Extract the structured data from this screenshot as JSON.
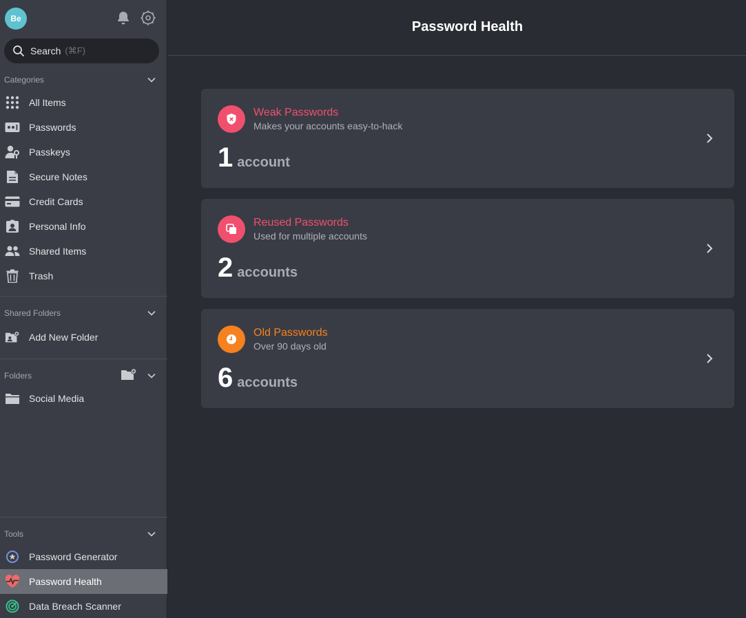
{
  "user": {
    "avatar_initials": "Be",
    "avatar_color": "#5fc2cf"
  },
  "search": {
    "label": "Search",
    "shortcut": "(⌘F)"
  },
  "categories": {
    "title": "Categories",
    "items": [
      {
        "label": "All Items",
        "icon": "grid-icon"
      },
      {
        "label": "Passwords",
        "icon": "password-icon"
      },
      {
        "label": "Passkeys",
        "icon": "passkey-icon"
      },
      {
        "label": "Secure Notes",
        "icon": "note-icon"
      },
      {
        "label": "Credit Cards",
        "icon": "credit-card-icon"
      },
      {
        "label": "Personal Info",
        "icon": "id-card-icon"
      },
      {
        "label": "Shared Items",
        "icon": "people-icon"
      },
      {
        "label": "Trash",
        "icon": "trash-icon"
      }
    ]
  },
  "shared_folders": {
    "title": "Shared Folders",
    "add_label": "Add New Folder"
  },
  "folders": {
    "title": "Folders",
    "items": [
      {
        "label": "Social Media",
        "icon": "folder-icon"
      }
    ]
  },
  "tools": {
    "title": "Tools",
    "items": [
      {
        "label": "Password Generator",
        "icon": "generator-icon"
      },
      {
        "label": "Password Health",
        "icon": "heart-pulse-icon",
        "active": true
      },
      {
        "label": "Data Breach Scanner",
        "icon": "radar-icon"
      }
    ]
  },
  "main": {
    "title": "Password Health",
    "cards": [
      {
        "title": "Weak Passwords",
        "subtitle": "Makes your accounts easy-to-hack",
        "count": "1",
        "unit": "account",
        "color": "#f0506e",
        "icon": "shield-x-icon"
      },
      {
        "title": "Reused Passwords",
        "subtitle": "Used for multiple accounts",
        "count": "2",
        "unit": "accounts",
        "color": "#f0506e",
        "icon": "copy-icon"
      },
      {
        "title": "Old Passwords",
        "subtitle": "Over 90 days old",
        "count": "6",
        "unit": "accounts",
        "color": "#f5821f",
        "icon": "clock-icon"
      }
    ]
  }
}
